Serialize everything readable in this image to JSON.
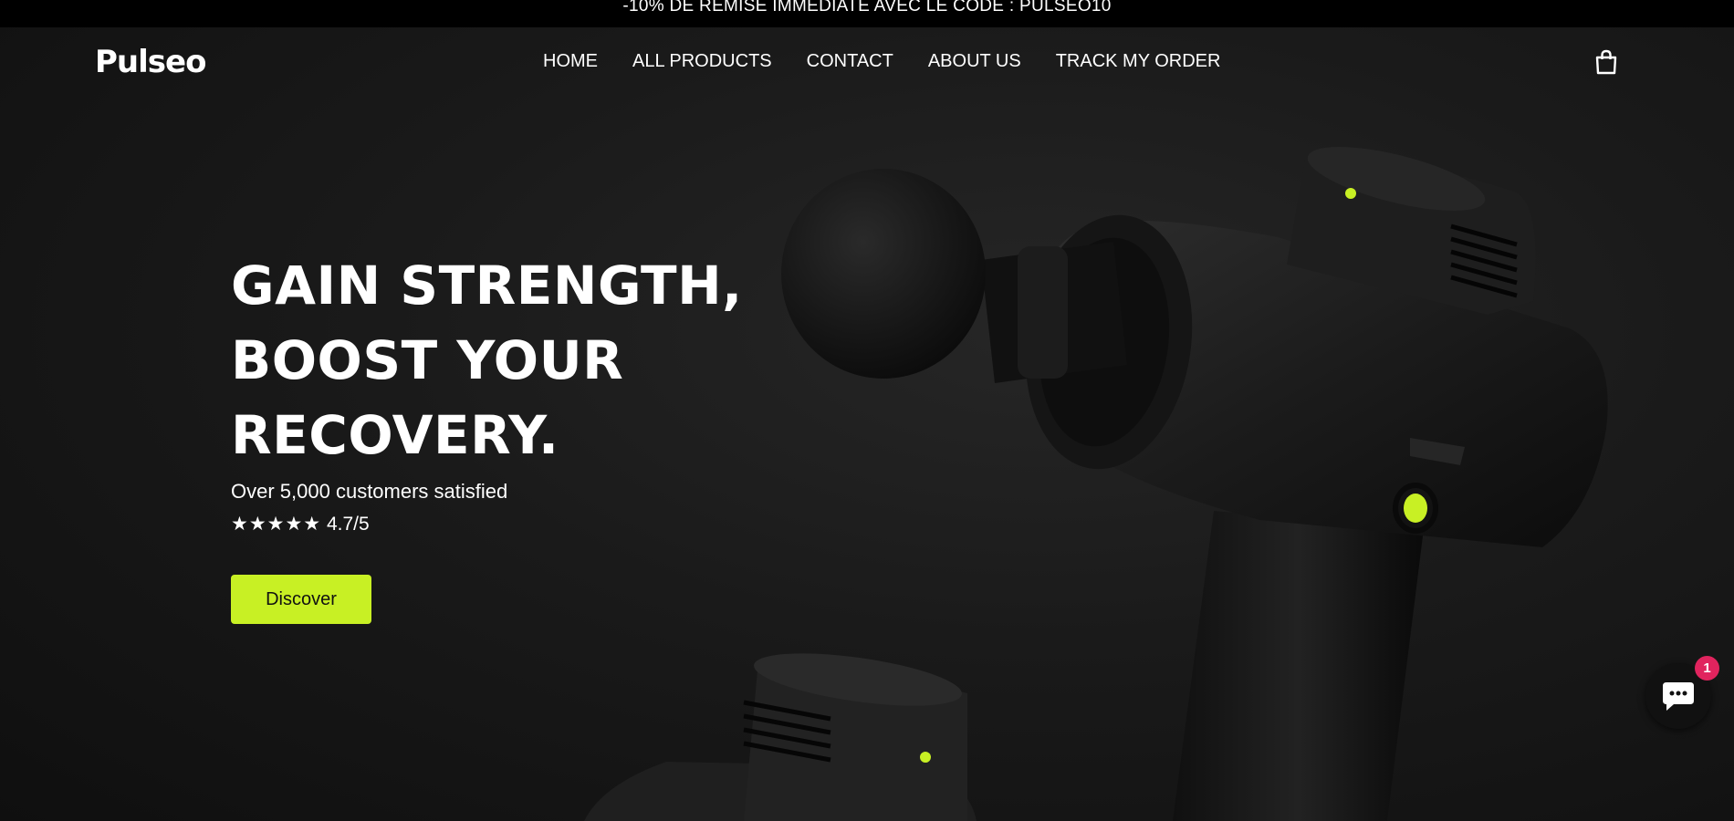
{
  "announcement": {
    "text": "-10% DE REMISE IMMÉDIATE AVEC LE CODE : PULSEO10"
  },
  "header": {
    "logo": "Pulseo",
    "nav": [
      {
        "label": "HOME"
      },
      {
        "label": "ALL PRODUCTS"
      },
      {
        "label": "CONTACT"
      },
      {
        "label": "ABOUT US"
      },
      {
        "label": "TRACK MY ORDER"
      }
    ],
    "cart_icon": "shopping-bag-icon"
  },
  "hero": {
    "title_lines": [
      "GAIN STRENGTH,",
      "BOOST YOUR",
      "RECOVERY."
    ],
    "subtitle": "Over 5,000 customers satisfied",
    "stars": "★★★★★",
    "rating": "4.7/5",
    "cta_label": "Discover"
  },
  "chat": {
    "icon": "chat-bubble-icon",
    "badge_count": "1"
  },
  "colors": {
    "accent": "#c8f024",
    "background": "#1a1a1a",
    "badge": "#e0245e"
  }
}
